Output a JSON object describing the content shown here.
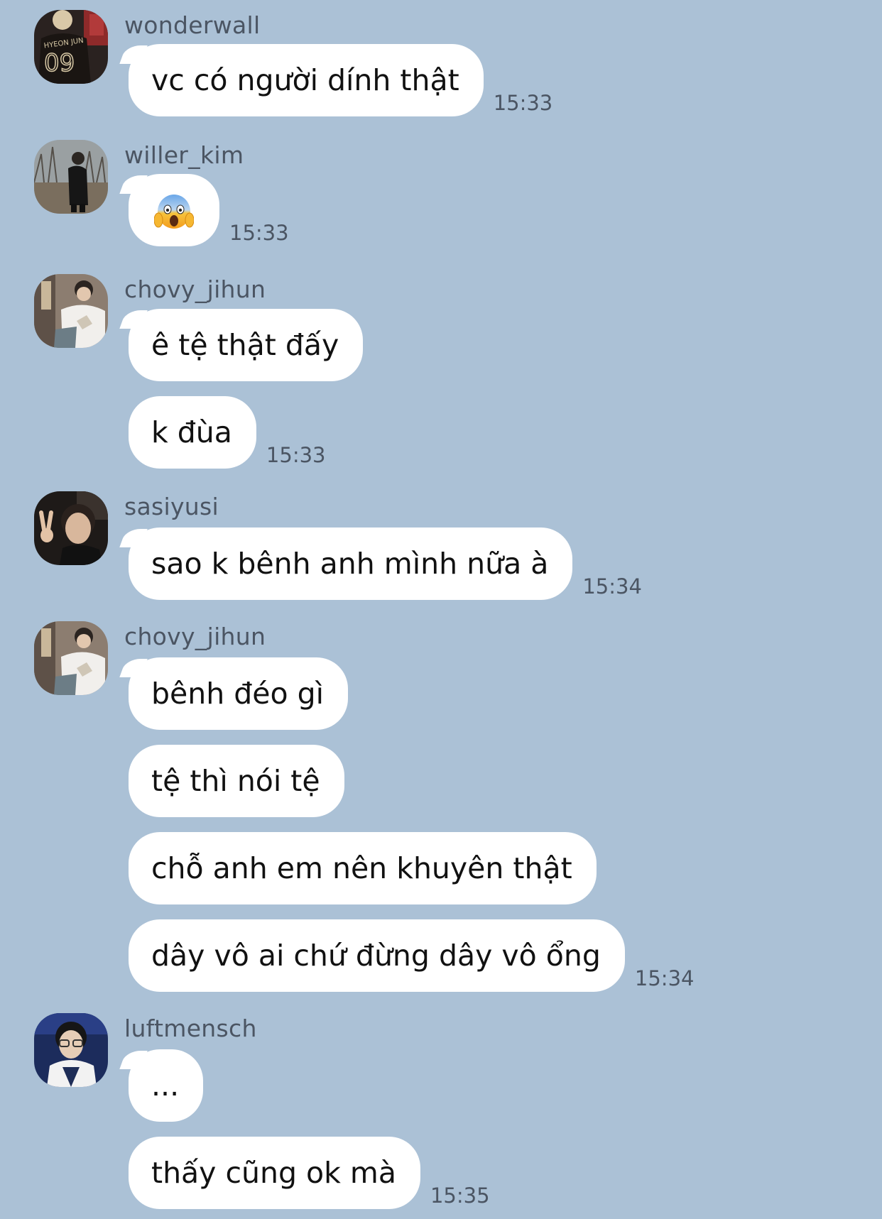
{
  "messages_groups": [
    {
      "sender": "wonderwall",
      "avatar_icon": "avatar-jersey-09-icon",
      "messages": [
        {
          "text": "vc có người dính thật",
          "time": "15:33"
        }
      ]
    },
    {
      "sender": "willer_kim",
      "avatar_icon": "avatar-outdoor-person-icon",
      "messages": [
        {
          "emoji": "face-screaming-in-fear",
          "time": "15:33"
        }
      ]
    },
    {
      "sender": "chovy_jihun",
      "avatar_icon": "avatar-white-shirt-person-icon",
      "messages": [
        {
          "text": "ê tệ thật đấy"
        },
        {
          "text": "k đùa",
          "time": "15:33"
        }
      ]
    },
    {
      "sender": "sasiyusi",
      "avatar_icon": "avatar-peace-sign-person-icon",
      "messages": [
        {
          "text": "sao k bênh anh mình nữa à",
          "time": "15:34"
        }
      ]
    },
    {
      "sender": "chovy_jihun",
      "avatar_icon": "avatar-white-shirt-person-icon",
      "messages": [
        {
          "text": "bênh đéo gì"
        },
        {
          "text": "tệ thì nói tệ"
        },
        {
          "text": "chỗ anh em nên khuyên thật"
        },
        {
          "text": "dây vô ai chứ đừng dây vô ổng",
          "time": "15:34"
        }
      ]
    },
    {
      "sender": "luftmensch",
      "avatar_icon": "avatar-glasses-person-icon",
      "messages": [
        {
          "text": "..."
        },
        {
          "text": "thấy cũng ok mà",
          "time": "15:35"
        }
      ]
    }
  ],
  "colors": {
    "background": "#abc1d6",
    "bubble": "#ffffff",
    "meta_text": "#4b5563"
  }
}
